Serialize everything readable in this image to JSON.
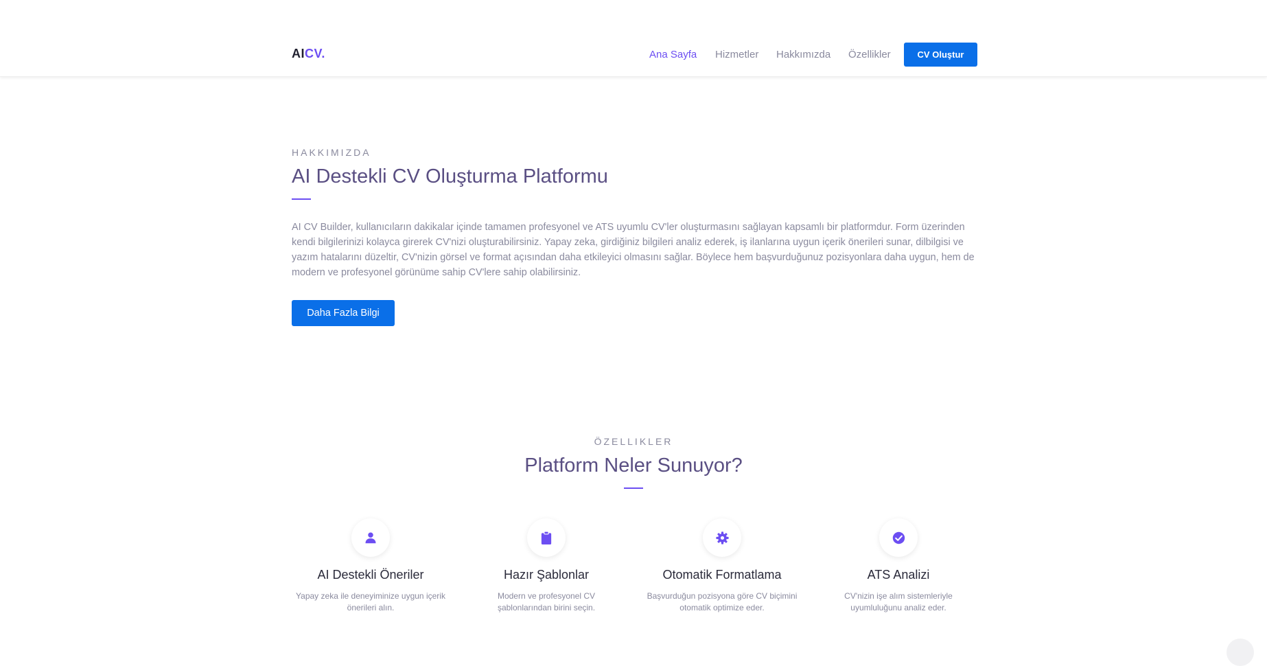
{
  "logo": {
    "part1": "AI",
    "part2": "CV."
  },
  "nav": {
    "items": [
      "Ana Sayfa",
      "Hizmetler",
      "Hakkımızda",
      "Özellikler"
    ],
    "cta": "CV Oluştur"
  },
  "about": {
    "subtitle": "HAKKIMIZDA",
    "title": "AI Destekli CV Oluşturma Platformu",
    "text": "AI CV Builder, kullanıcıların dakikalar içinde tamamen profesyonel ve ATS uyumlu CV'ler oluşturmasını sağlayan kapsamlı bir platformdur. Form üzerinden kendi bilgilerinizi kolayca girerek CV'nizi oluşturabilirsiniz. Yapay zeka, girdiğiniz bilgileri analiz ederek, iş ilanlarına uygun içerik önerileri sunar, dilbilgisi ve yazım hatalarını düzeltir, CV'nizin görsel ve format açısından daha etkileyici olmasını sağlar. Böylece hem başvurduğunuz pozisyonlara daha uygun, hem de modern ve profesyonel görünüme sahip CV'lere sahip olabilirsiniz.",
    "button": "Daha Fazla Bilgi"
  },
  "features": {
    "subtitle": "ÖZELLIKLER",
    "title": "Platform Neler Sunuyor?",
    "items": [
      {
        "icon": "user-icon",
        "title": "AI Destekli Öneriler",
        "desc": "Yapay zeka ile deneyiminize uygun içerik önerileri alın."
      },
      {
        "icon": "clipboard-icon",
        "title": "Hazır Şablonlar",
        "desc": "Modern ve profesyonel CV şablonlarından birini seçin."
      },
      {
        "icon": "gear-icon",
        "title": "Otomatik Formatlama",
        "desc": "Başvurduğun pozisyona göre CV biçimini otomatik optimize eder."
      },
      {
        "icon": "check-circle-icon",
        "title": "ATS Analizi",
        "desc": "CV'nizin işe alım sistemleriyle uyumluluğunu analiz eder."
      }
    ]
  },
  "colors": {
    "accent": "#6c4ef2",
    "primary_button": "#0a6fe8",
    "heading": "#5a4f83",
    "muted_text": "#8a8a9e"
  }
}
